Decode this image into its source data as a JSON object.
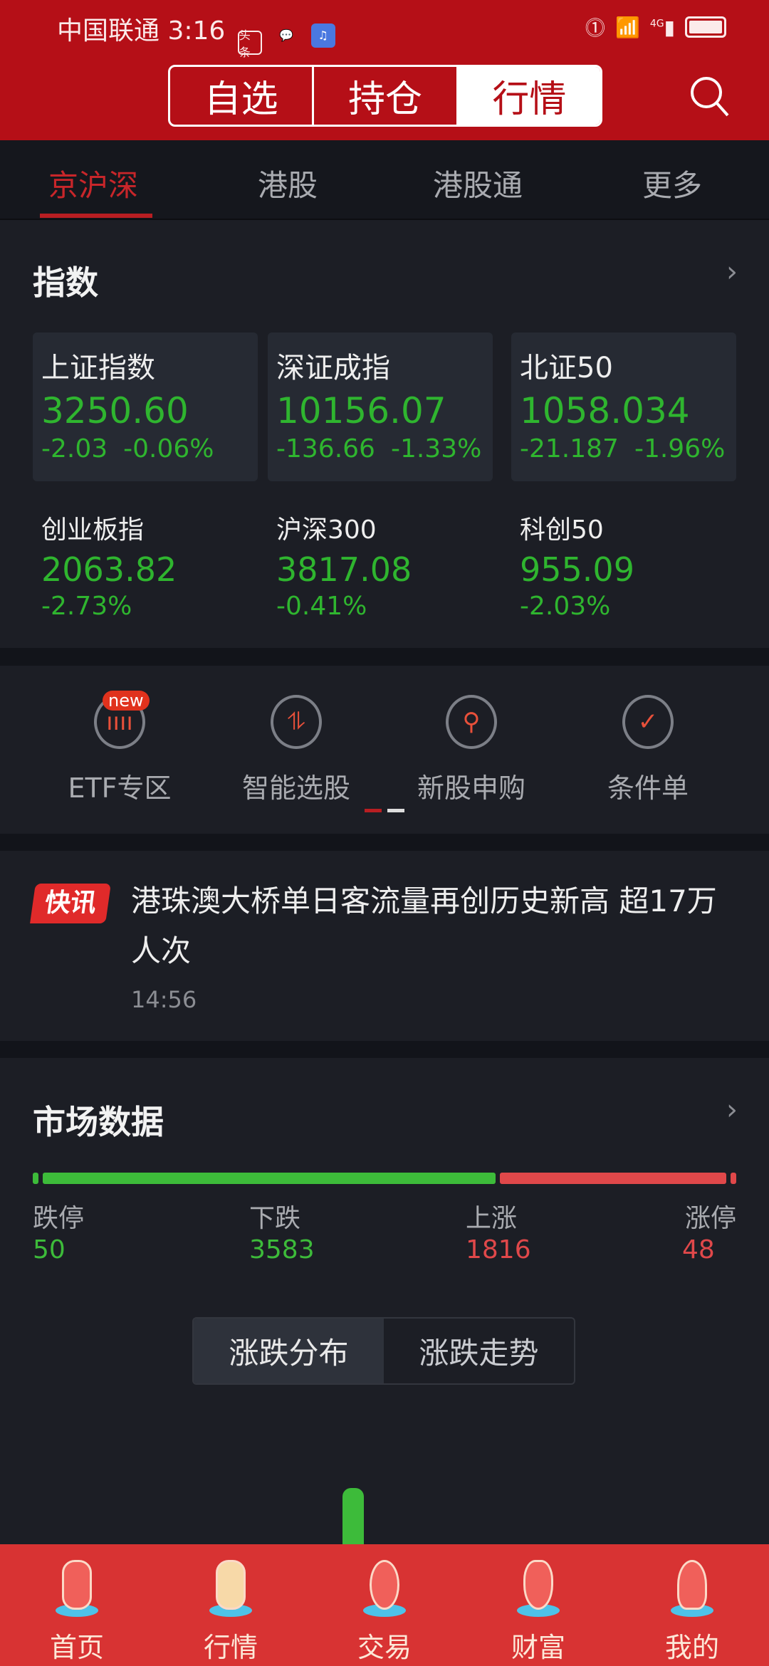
{
  "status_bar": {
    "carrier": "中国联通",
    "time": "3:16",
    "app_icons": [
      "toutiao-icon",
      "wechat-icon",
      "music-icon"
    ],
    "toutiao_label": "头条",
    "right_icons": [
      "hd-call-icon",
      "wifi-icon",
      "4g-signal-icon",
      "battery-icon"
    ],
    "network": "4G"
  },
  "header": {
    "segments": [
      "自选",
      "持仓",
      "行情"
    ],
    "active_segment": "行情",
    "search_icon": "search-icon"
  },
  "tabs": {
    "items": [
      "京沪深",
      "港股",
      "港股通",
      "更多"
    ],
    "active": "京沪深"
  },
  "indices": {
    "title": "指数",
    "items": [
      {
        "name": "上证指数",
        "value": "3250.60",
        "change": "-2.03",
        "pct": "-0.06%"
      },
      {
        "name": "深证成指",
        "value": "10156.07",
        "change": "-136.66",
        "pct": "-1.33%"
      },
      {
        "name": "北证50",
        "value": "1058.034",
        "change": "-21.187",
        "pct": "-1.96%"
      },
      {
        "name": "创业板指",
        "value": "2063.82",
        "pct": "-2.73%"
      },
      {
        "name": "沪深300",
        "value": "3817.08",
        "pct": "-0.41%"
      },
      {
        "name": "科创50",
        "value": "955.09",
        "pct": "-2.03%"
      }
    ]
  },
  "shortcuts": {
    "items": [
      {
        "label": "ETF专区",
        "badge": "new",
        "icon": "etf-icon"
      },
      {
        "label": "智能选股",
        "icon": "smart-pick-icon"
      },
      {
        "label": "新股申购",
        "icon": "ipo-icon"
      },
      {
        "label": "条件单",
        "icon": "conditional-order-icon"
      }
    ],
    "page": 1,
    "pages": 2
  },
  "news": {
    "tag": "快讯",
    "headline": "港珠澳大桥单日客流量再创历史新高 超17万人次",
    "time": "14:56"
  },
  "market": {
    "title": "市场数据",
    "stats": [
      {
        "label": "跌停",
        "value": "50"
      },
      {
        "label": "下跌",
        "value": "3583"
      },
      {
        "label": "上涨",
        "value": "1816"
      },
      {
        "label": "涨停",
        "value": "48"
      }
    ],
    "toggle": [
      "涨跌分布",
      "涨跌走势"
    ],
    "active_toggle": "涨跌分布"
  },
  "colors": {
    "header": "#b50f17",
    "down": "#3dbb3a",
    "up": "#e0484a",
    "nav": "#d83333"
  },
  "nav": {
    "items": [
      "首页",
      "行情",
      "交易",
      "财富",
      "我的"
    ],
    "active": "行情"
  }
}
